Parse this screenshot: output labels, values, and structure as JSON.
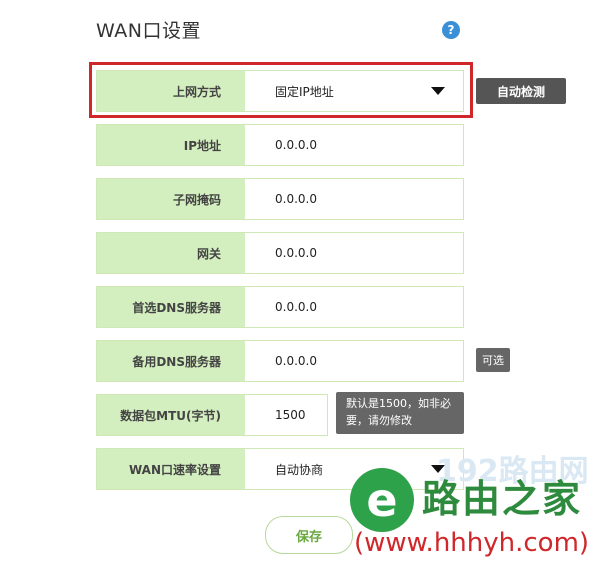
{
  "page": {
    "title": "WAN口设置",
    "help_icon": "question-circle-icon"
  },
  "form": {
    "rows": [
      {
        "label": "上网方式",
        "value": "固定IP地址"
      },
      {
        "label": "IP地址",
        "value": "0.0.0.0"
      },
      {
        "label": "子网掩码",
        "value": "0.0.0.0"
      },
      {
        "label": "网关",
        "value": "0.0.0.0"
      },
      {
        "label": "首选DNS服务器",
        "value": "0.0.0.0"
      },
      {
        "label": "备用DNS服务器",
        "value": "0.0.0.0"
      },
      {
        "label": "数据包MTU(字节)",
        "value": "1500"
      },
      {
        "label": "WAN口速率设置",
        "value": "自动协商"
      }
    ]
  },
  "buttons": {
    "auto_detect": "自动检测",
    "save": "保存"
  },
  "badges": {
    "optional": "可选",
    "mtu_hint": "默认是1500，如非必要，请勿修改"
  },
  "watermark": {
    "brand": "路由之家",
    "faint": "192路由网",
    "url": "(www.hhhyh.com)"
  },
  "colors": {
    "label_bg": "#d4efbf",
    "highlight": "#d0272a",
    "accent_green": "#6aa840"
  }
}
